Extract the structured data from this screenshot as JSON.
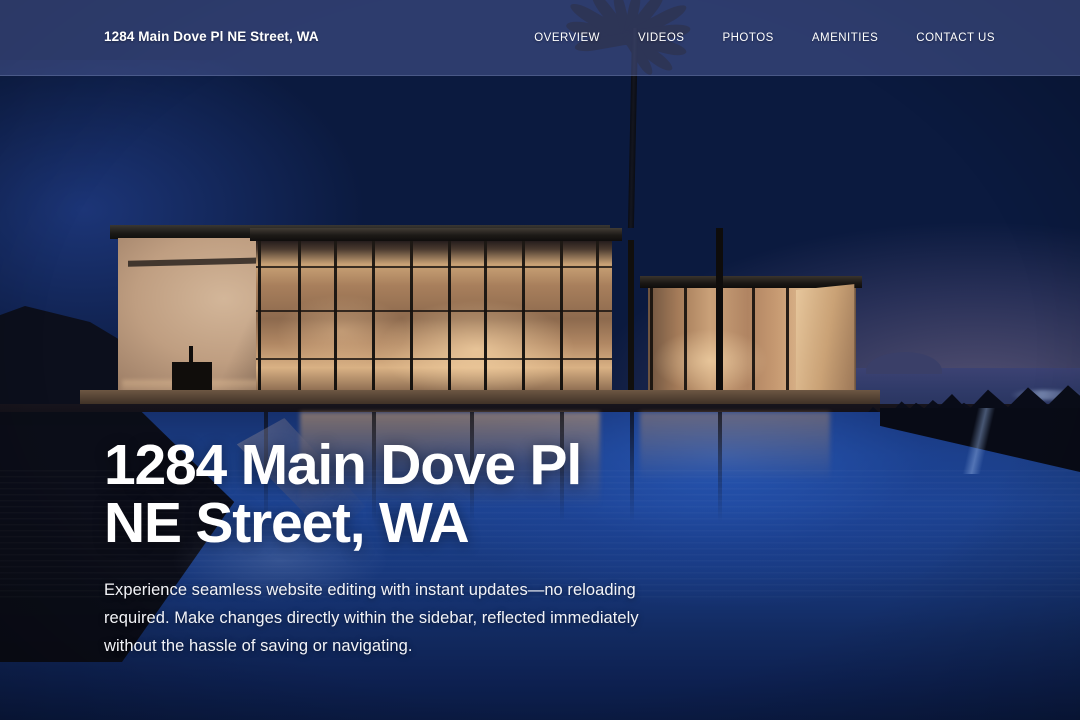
{
  "header": {
    "brand": "1284 Main Dove Pl NE Street, WA",
    "nav": [
      {
        "label": "OVERVIEW"
      },
      {
        "label": "VIDEOS"
      },
      {
        "label": "PHOTOS"
      },
      {
        "label": "AMENITIES"
      },
      {
        "label": "CONTACT US"
      }
    ]
  },
  "hero": {
    "title": "1284  Main Dove Pl\nNE Street, WA",
    "description": "Experience seamless website editing with instant updates—no reloading required. Make changes directly within the sidebar, reflected immediately without the hassle of saving or navigating."
  },
  "colors": {
    "header_overlay": "#5c6caf",
    "sky_deep_blue": "#143campaign",
    "sky_blue": "#16357f",
    "dusk_purple": "#4d4470",
    "pool_blue": "#1d4391",
    "pool_deep_navy": "#0d2050",
    "villa_warm_light": "#d3b699",
    "text_white": "#ffffff"
  },
  "scene": {
    "description": "Modern glass villa at dusk with infinity pool and palm tree"
  }
}
